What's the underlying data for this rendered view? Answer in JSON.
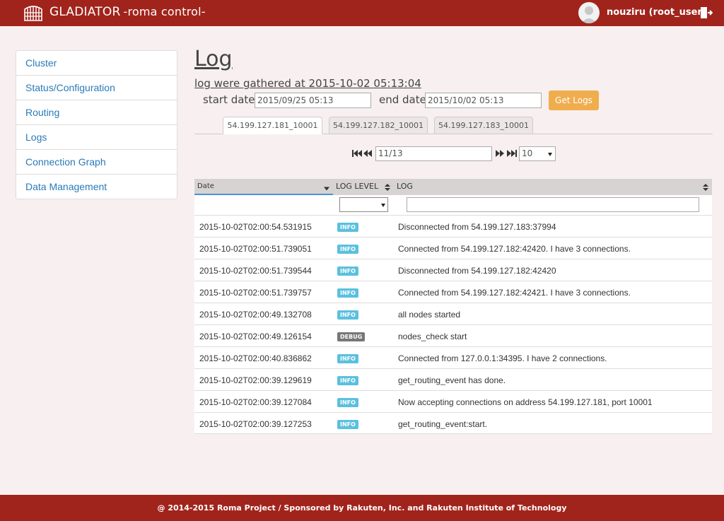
{
  "header": {
    "brand": "GLADIATOR",
    "brand_sub": "-roma control-",
    "username": "nouziru (root_user)"
  },
  "sidebar": {
    "items": [
      {
        "label": "Cluster"
      },
      {
        "label": "Status/Configuration"
      },
      {
        "label": "Routing"
      },
      {
        "label": "Logs"
      },
      {
        "label": "Connection Graph"
      },
      {
        "label": "Data Management"
      }
    ]
  },
  "main": {
    "title": "Log",
    "gathered": "log were gathered at 2015-10-02 05:13:04",
    "start_label": "start date:",
    "start_value": "2015/09/25 05:13",
    "end_label": "end date:",
    "end_value": "2015/10/02 05:13",
    "get_logs_label": "Get Logs",
    "tabs": [
      {
        "label": "54.199.127.181_10001",
        "active": true
      },
      {
        "label": "54.199.127.182_10001",
        "active": false
      },
      {
        "label": "54.199.127.183_10001",
        "active": false
      }
    ],
    "pager": {
      "page": "11/13",
      "page_size": "10"
    },
    "columns": {
      "date": "Date",
      "level": "LOG LEVEL",
      "log": "LOG"
    },
    "rows": [
      {
        "date": "2015-10-02T02:00:54.531915",
        "level": "INFO",
        "log": "Disconnected from 54.199.127.183:37994"
      },
      {
        "date": "2015-10-02T02:00:51.739051",
        "level": "INFO",
        "log": "Connected from 54.199.127.182:42420. I have 3 connections."
      },
      {
        "date": "2015-10-02T02:00:51.739544",
        "level": "INFO",
        "log": "Disconnected from 54.199.127.182:42420"
      },
      {
        "date": "2015-10-02T02:00:51.739757",
        "level": "INFO",
        "log": "Connected from 54.199.127.182:42421. I have 3 connections."
      },
      {
        "date": "2015-10-02T02:00:49.132708",
        "level": "INFO",
        "log": "all nodes started"
      },
      {
        "date": "2015-10-02T02:00:49.126154",
        "level": "DEBUG",
        "log": "nodes_check start"
      },
      {
        "date": "2015-10-02T02:00:40.836862",
        "level": "INFO",
        "log": "Connected from 127.0.0.1:34395. I have 2 connections."
      },
      {
        "date": "2015-10-02T02:00:39.129619",
        "level": "INFO",
        "log": "get_routing_event has done."
      },
      {
        "date": "2015-10-02T02:00:39.127084",
        "level": "INFO",
        "log": "Now accepting connections on address 54.199.127.181, port 10001"
      },
      {
        "date": "2015-10-02T02:00:39.127253",
        "level": "INFO",
        "log": "get_routing_event:start."
      }
    ]
  },
  "footer": {
    "text": "@ 2014-2015 Roma Project / Sponsored by Rakuten, Inc. and Rakuten Institute of Technology"
  },
  "colors": {
    "brand_red": "#a1241c",
    "link_blue": "#2a7ab8",
    "button_orange": "#f0ad4e",
    "info_badge": "#5bc0de",
    "debug_badge": "#777777"
  },
  "icons": {
    "logo": "colosseum-logo-icon",
    "logout": "logout-icon",
    "first": "first-page-icon",
    "prev": "prev-page-icon",
    "next": "next-page-icon",
    "last": "last-page-icon"
  }
}
